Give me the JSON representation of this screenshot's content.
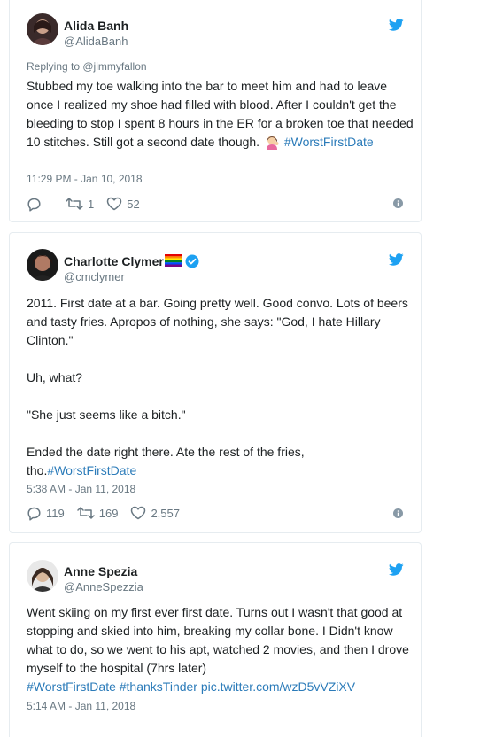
{
  "colors": {
    "link": "#2b7bb9",
    "muted": "#697882",
    "twitter_blue": "#1da1f2",
    "verified": "#1da1f2"
  },
  "tweets": [
    {
      "name": "Alida Banh",
      "handle": "@AlidaBanh",
      "reply_prefix": "Replying to ",
      "reply_to": "@jimmyfallon",
      "text": "Stubbed my toe walking into the bar to meet him and had to leave once I realized my shoe had filled with blood. After I couldn't get the bleeding to stop I spent 8 hours in the ER for a broken toe that needed 10 stitches. Still got a second date though. ",
      "hashtag": "#WorstFirstDate",
      "timestamp": "11:29 PM - Jan 10, 2018",
      "replies": "",
      "retweets": "1",
      "likes": "52"
    },
    {
      "name": "Charlotte Clymer",
      "handle": "@cmclymer",
      "text": "2011. First date at a bar. Going pretty well. Good convo. Lots of beers and tasty fries. Apropos of nothing, she says: \"God, I hate Hillary Clinton.\"\n\nUh, what?\n\n\"She just seems like a bitch.\"\n\nEnded the date right there. Ate the rest of the fries, tho.",
      "hashtag": "#WorstFirstDate",
      "timestamp": "5:38 AM - Jan 11, 2018",
      "replies": "119",
      "retweets": "169",
      "likes": "2,557"
    },
    {
      "name": "Anne Spezia",
      "handle": "@AnneSpezzia",
      "text": "Went skiing on my first ever first date. Turns out I wasn't that good at stopping and skied into him, breaking my collar bone. I Didn't know what to do, so we went to his apt, watched 2 movies, and then I drove myself to the hospital (7hrs later)\n",
      "hashtags": "#WorstFirstDate #thanksTinder pic.twitter.com/wzD5vVZiXV",
      "timestamp": "5:14 AM - Jan 11, 2018"
    }
  ]
}
